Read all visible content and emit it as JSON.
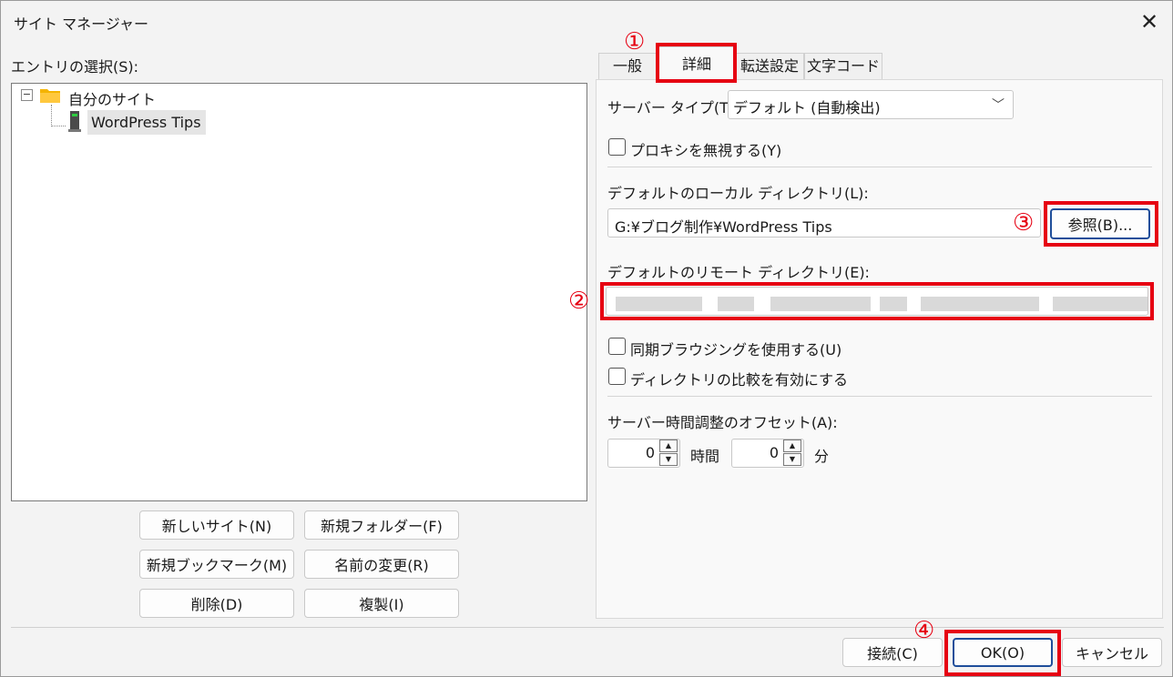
{
  "window": {
    "title": "サイト マネージャー"
  },
  "left": {
    "entry_label": "エントリの選択(S):",
    "tree": {
      "folder_label": "自分のサイト",
      "site_label": "WordPress Tips"
    },
    "buttons": {
      "new_site": "新しいサイト(N)",
      "new_folder": "新規フォルダー(F)",
      "new_bookmark": "新規ブックマーク(M)",
      "rename": "名前の変更(R)",
      "delete": "削除(D)",
      "duplicate": "複製(I)"
    }
  },
  "tabs": [
    {
      "label": "一般"
    },
    {
      "label": "詳細"
    },
    {
      "label": "転送設定"
    },
    {
      "label": "文字コード"
    }
  ],
  "advanced": {
    "server_type_label": "サーバー タイプ(T):",
    "server_type_value": "デフォルト (自動検出)",
    "bypass_proxy_label": "プロキシを無視する(Y)",
    "local_dir_label": "デフォルトのローカル ディレクトリ(L):",
    "local_dir_value": "G:¥ブログ制作¥WordPress Tips",
    "browse_label": "参照(B)...",
    "remote_dir_label": "デフォルトのリモート ディレクトリ(E):",
    "sync_browsing_label": "同期ブラウジングを使用する(U)",
    "dir_compare_label": "ディレクトリの比較を有効にする",
    "time_offset_label": "サーバー時間調整のオフセット(A):",
    "hours_value": "0",
    "hours_unit": "時間",
    "minutes_value": "0",
    "minutes_unit": "分"
  },
  "annotations": {
    "n1": "①",
    "n2": "②",
    "n3": "③",
    "n4": "④",
    "color": "#e60012"
  },
  "footer": {
    "connect": "接続(C)",
    "ok": "OK(O)",
    "cancel": "キャンセル"
  }
}
